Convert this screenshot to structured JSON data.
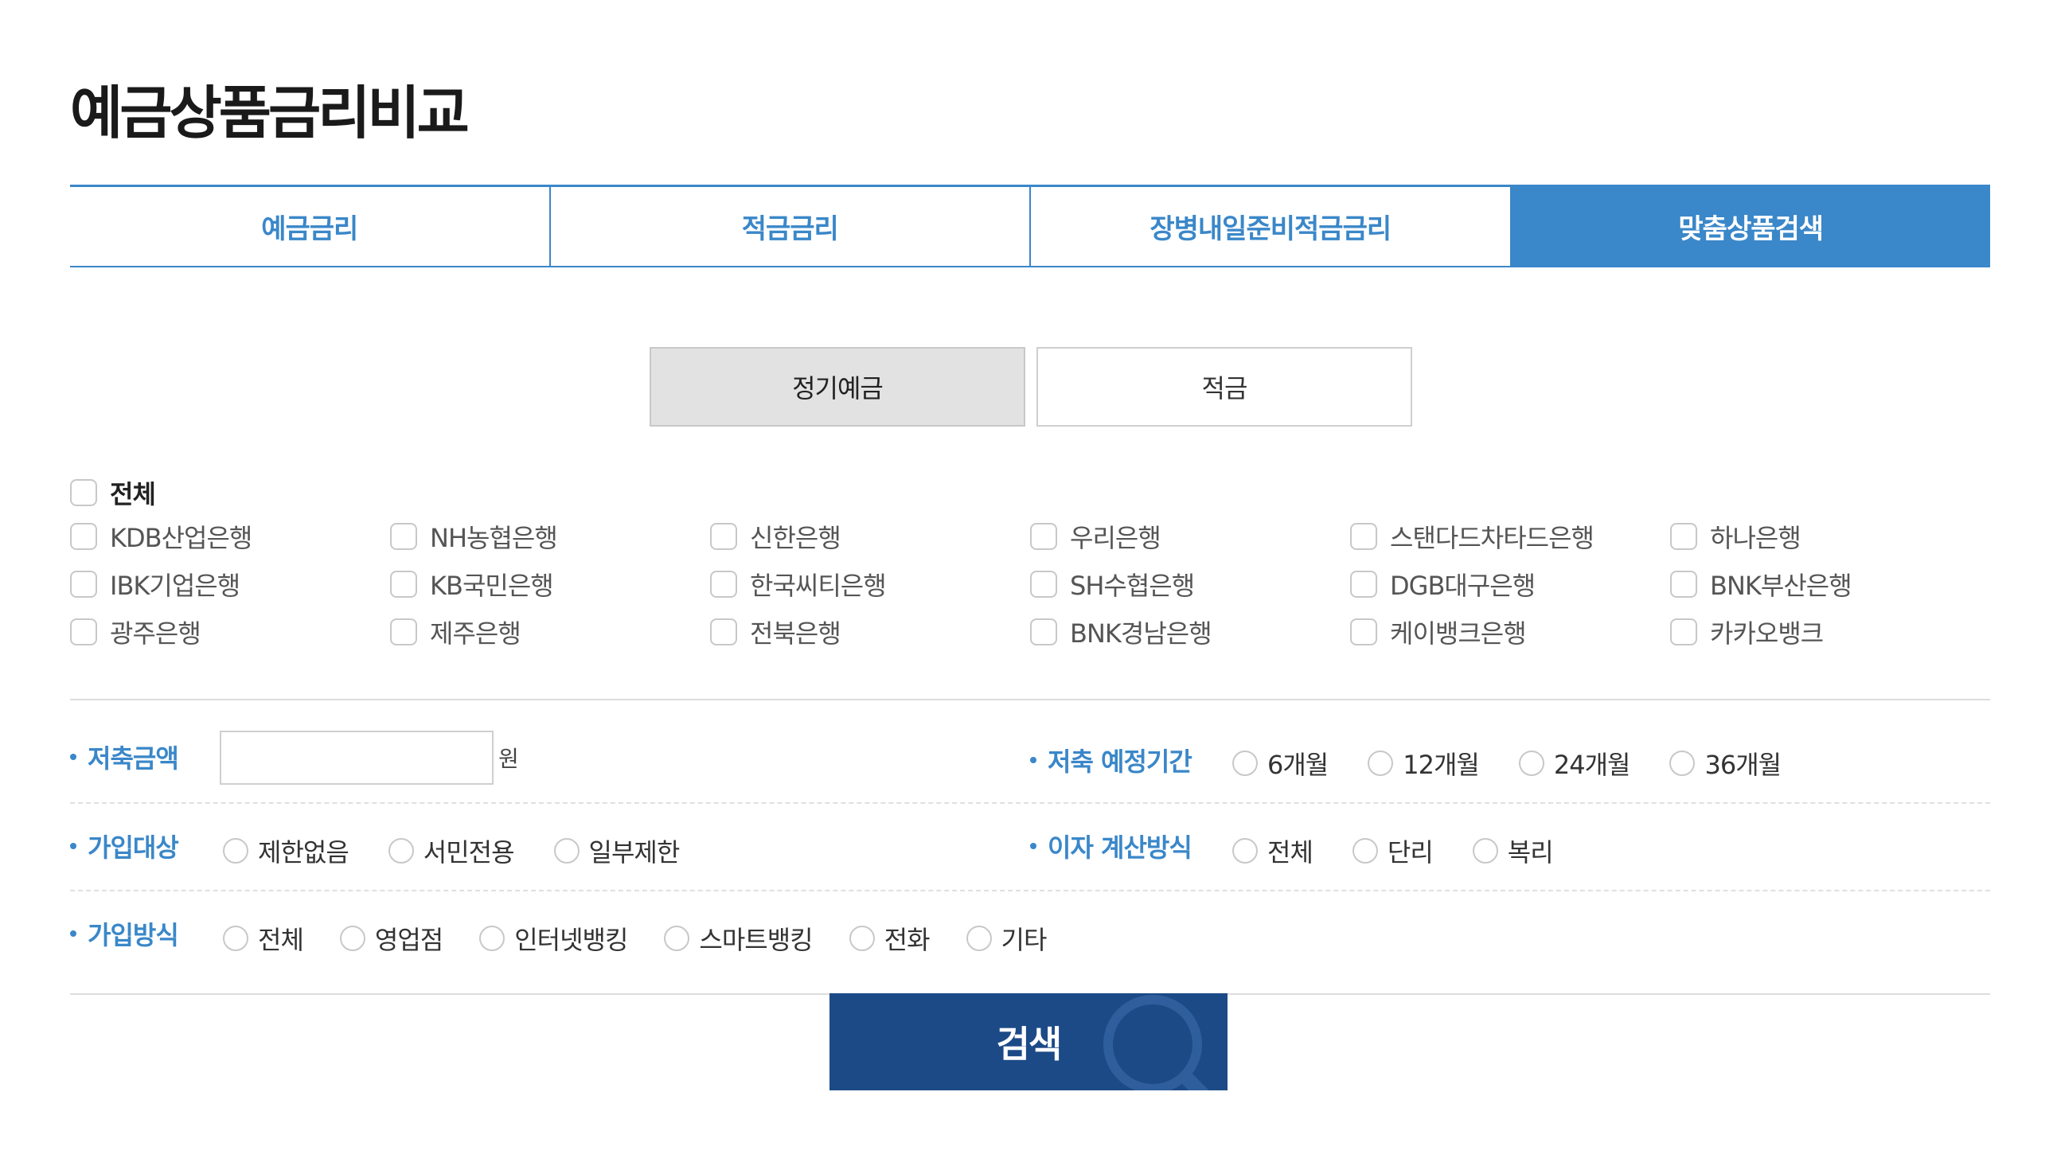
{
  "page": {
    "title": "예금상품금리비교"
  },
  "main_tabs": [
    {
      "label": "예금금리"
    },
    {
      "label": "적금금리"
    },
    {
      "label": "장병내일준비적금금리"
    },
    {
      "label": "맞춤상품검색"
    }
  ],
  "sub_tabs": [
    {
      "label": "정기예금"
    },
    {
      "label": "적금"
    }
  ],
  "banks": {
    "all_label": "전체",
    "items": [
      "KDB산업은행",
      "NH농협은행",
      "신한은행",
      "우리은행",
      "스탠다드차타드은행",
      "하나은행",
      "IBK기업은행",
      "KB국민은행",
      "한국씨티은행",
      "SH수협은행",
      "DGB대구은행",
      "BNK부산은행",
      "광주은행",
      "제주은행",
      "전북은행",
      "BNK경남은행",
      "케이뱅크은행",
      "카카오뱅크"
    ]
  },
  "savings_amount": {
    "label": "저축금액",
    "value": "",
    "unit": "원"
  },
  "savings_period": {
    "label": "저축 예정기간",
    "options": [
      "6개월",
      "12개월",
      "24개월",
      "36개월"
    ]
  },
  "join_target": {
    "label": "가입대상",
    "options": [
      "제한없음",
      "서민전용",
      "일부제한"
    ]
  },
  "interest_method": {
    "label": "이자 계산방식",
    "options": [
      "전체",
      "단리",
      "복리"
    ]
  },
  "join_method": {
    "label": "가입방식",
    "options": [
      "전체",
      "영업점",
      "인터넷뱅킹",
      "스마트뱅킹",
      "전화",
      "기타"
    ]
  },
  "search_button": {
    "label": "검색"
  },
  "colors": {
    "accent": "#3a87c9",
    "button": "#1c4a87"
  }
}
